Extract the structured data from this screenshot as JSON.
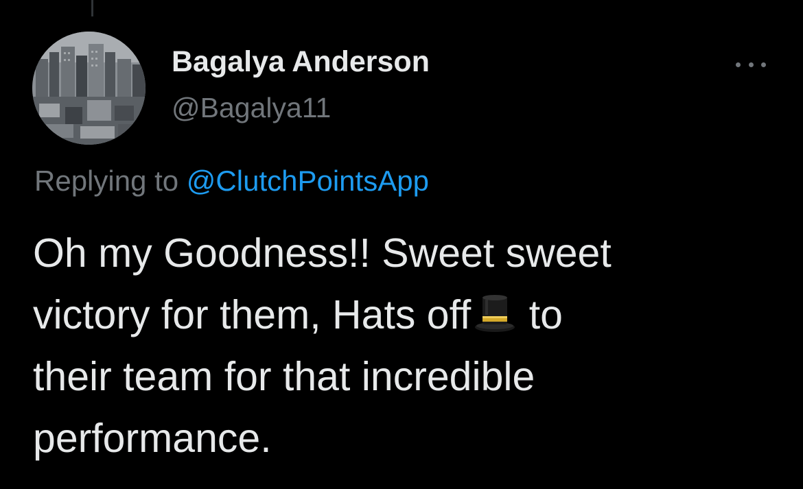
{
  "author": {
    "display_name": "Bagalya Anderson",
    "handle": "@Bagalya11",
    "avatar_icon": "city-skyline-avatar"
  },
  "menu": {
    "icon": "more-horizontal-icon"
  },
  "reply": {
    "prefix": "Replying to ",
    "mention": "@ClutchPointsApp"
  },
  "tweet": {
    "line1": "Oh my Goodness!! Sweet sweet",
    "line2_before_emoji": "victory for them, Hats off",
    "emoji": "top-hat-emoji",
    "line2_after_emoji": " to",
    "line3": "their team for that incredible",
    "line4": "performance."
  },
  "colors": {
    "background": "#000000",
    "primary_text": "#e7e9ea",
    "secondary_text": "#71767b",
    "link": "#1d9bf0"
  }
}
